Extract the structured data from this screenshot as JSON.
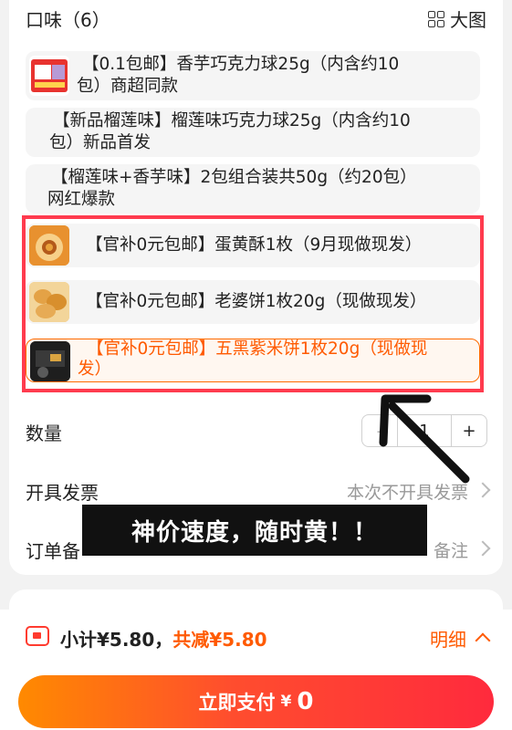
{
  "section": {
    "title": "口味（6）",
    "view_toggle": "大图"
  },
  "options": [
    {
      "label_line1": "【0.1包邮】香芋巧克力球25g（内含约10",
      "label_line2": "包）商超同款",
      "thumb": "product-thumb-taro"
    },
    {
      "label_line1": "【新品榴莲味】榴莲味巧克力球25g（内含约10",
      "label_line2": "包）新品首发"
    },
    {
      "label_line1": "【榴莲味+香芋味】2包组合装共50g（约20包）",
      "label_line2": "网红爆款"
    },
    {
      "label_line1": "【官补0元包邮】蛋黄酥1枚（9月现做现发）",
      "thumb": "product-thumb-egg-yolk-pastry"
    },
    {
      "label_line1": "【官补0元包邮】老婆饼1枚20g（现做现发）",
      "thumb": "product-thumb-wife-cake"
    },
    {
      "label_line1": "【官补0元包邮】五黑紫米饼1枚20g（现做现",
      "label_line2": "发）",
      "thumb": "product-thumb-purple-rice-cake",
      "selected": true
    }
  ],
  "quantity": {
    "label": "数量",
    "minus": "-",
    "value": "1",
    "plus": "+"
  },
  "invoice": {
    "label": "开具发票",
    "value": "本次不开具发票"
  },
  "order_note": {
    "label": "订单备",
    "value": "备注"
  },
  "overlay_caption": "神价速度，随时黄！！",
  "footer": {
    "subtotal": "小计¥5.80，",
    "discount": "共减¥5.80",
    "detail": "明细",
    "pay_label": "立即支付",
    "pay_currency": "¥",
    "pay_amount": "0"
  },
  "colors": {
    "accent": "#ff5a00",
    "highlight": "#ff3b4e"
  }
}
